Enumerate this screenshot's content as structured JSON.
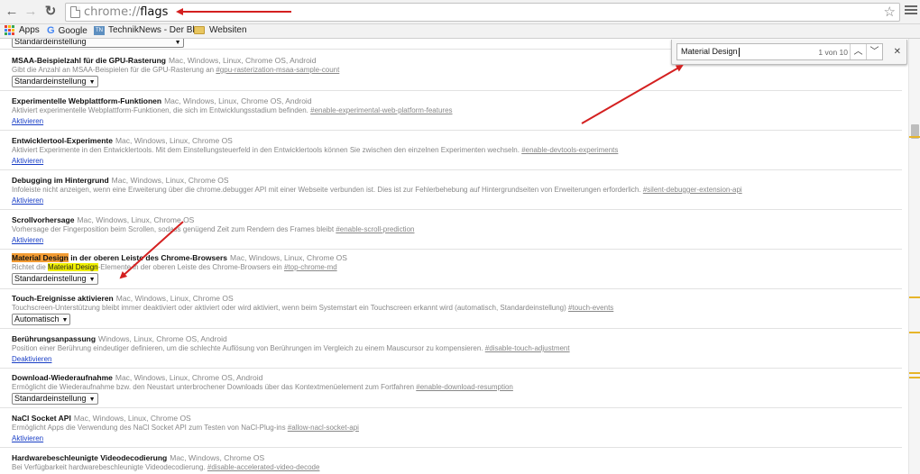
{
  "toolbar": {
    "back_icon": "back-arrow-icon",
    "forward_icon": "forward-arrow-icon",
    "reload_icon": "reload-icon",
    "url_scheme": "chrome://",
    "url_host": "flags",
    "star_icon": "bookmark-star-icon",
    "menu_icon": "hamburger-menu-icon"
  },
  "bookmarks": [
    {
      "label": "Apps",
      "icon": "apps-grid-icon"
    },
    {
      "label": "Google",
      "icon": "google-icon"
    },
    {
      "label": "TechnikNews - Der Bl",
      "icon": "technik-news-icon"
    },
    {
      "label": "Websiten",
      "icon": "folder-icon"
    }
  ],
  "find_bar": {
    "query": "Material Design",
    "count": "1 von 10",
    "prev_icon": "chevron-up-icon",
    "next_icon": "chevron-down-icon",
    "close_icon": "close-icon"
  },
  "top_partial_select": "Standardeinstellung",
  "flags": [
    {
      "title": "MSAA-Beispielzahl für die GPU-Rasterung",
      "platforms": "Mac, Windows, Linux, Chrome OS, Android",
      "desc": "Gibt die Anzahl an MSAA-Beispielen für die GPU-Rasterung an",
      "anchor": "#gpu-rasterization-msaa-sample-count",
      "control": "select",
      "value": "Standardeinstellung"
    },
    {
      "title": "Experimentelle Webplattform-Funktionen",
      "platforms": "Mac, Windows, Linux, Chrome OS, Android",
      "desc": "Aktiviert experimentelle Webplattform-Funktionen, die sich im Entwicklungsstadium befinden.",
      "anchor": "#enable-experimental-web-platform-features",
      "control": "link",
      "value": "Aktivieren"
    },
    {
      "title": "Entwicklertool-Experimente",
      "platforms": "Mac, Windows, Linux, Chrome OS",
      "desc": "Aktiviert Experimente in den Entwicklertools. Mit dem Einstellungsteuerfeld in den Entwicklertools können Sie zwischen den einzelnen Experimenten wechseln.",
      "anchor": "#enable-devtools-experiments",
      "control": "link",
      "value": "Aktivieren"
    },
    {
      "title": "Debugging im Hintergrund",
      "platforms": "Mac, Windows, Linux, Chrome OS",
      "desc": "Infoleiste nicht anzeigen, wenn eine Erweiterung über die chrome.debugger API mit einer Webseite verbunden ist. Dies ist zur Fehlerbehebung auf Hintergrundseiten von Erweiterungen erforderlich.",
      "anchor": "#silent-debugger-extension-api",
      "control": "link",
      "value": "Aktivieren"
    },
    {
      "title": "Scrollvorhersage",
      "platforms": "Mac, Windows, Linux, Chrome OS",
      "desc": "Vorhersage der Fingerposition beim Scrollen, sodass genügend Zeit zum Rendern des Frames bleibt",
      "anchor": "#enable-scroll-prediction",
      "control": "link",
      "value": "Aktivieren"
    },
    {
      "title_match": "Material Design",
      "title_rest": " in der oberen Leiste des Chrome-Browsers",
      "platforms": "Mac, Windows, Linux, Chrome OS",
      "desc_pre": "Richtet die ",
      "desc_match": "Material Design",
      "desc_post": "-Elemente in der oberen Leiste des Chrome-Browsers ein",
      "anchor": "#top-chrome-md",
      "control": "select",
      "value": "Standardeinstellung"
    },
    {
      "title": "Touch-Ereignisse aktivieren",
      "platforms": "Mac, Windows, Linux, Chrome OS",
      "desc": "Touchscreen-Unterstützung bleibt immer deaktiviert oder aktiviert oder wird aktiviert, wenn beim Systemstart ein Touchscreen erkannt wird (automatisch, Standardeinstellung)",
      "anchor": "#touch-events",
      "control": "select",
      "value": "Automatisch"
    },
    {
      "title": "Berührungsanpassung",
      "platforms": "Windows, Linux, Chrome OS, Android",
      "desc": "Position einer Berührung eindeutiger definieren, um die schlechte Auflösung von Berührungen im Vergleich zu einem Mauscursor zu kompensieren.",
      "anchor": "#disable-touch-adjustment",
      "control": "link",
      "value": "Deaktivieren"
    },
    {
      "title": "Download-Wiederaufnahme",
      "platforms": "Mac, Windows, Linux, Chrome OS, Android",
      "desc": "Ermöglicht die Wiederaufnahme bzw. den Neustart unterbrochener Downloads über das Kontextmenüelement zum Fortfahren",
      "anchor": "#enable-download-resumption",
      "control": "select",
      "value": "Standardeinstellung"
    },
    {
      "title": "NaCl Socket API",
      "platforms": "Mac, Windows, Linux, Chrome OS",
      "desc": "Ermöglicht Apps die Verwendung des NaCl Socket API zum Testen von NaCl-Plug-ins",
      "anchor": "#allow-nacl-socket-api",
      "control": "link",
      "value": "Aktivieren"
    },
    {
      "title": "Hardwarebeschleunigte Videodecodierung",
      "platforms": "Mac, Windows, Chrome OS",
      "desc": "Bei Verfügbarkeit hardwarebeschleunigte Videodecodierung.",
      "anchor": "#disable-accelerated-video-decode",
      "control": "none",
      "value": ""
    }
  ],
  "colors": {
    "annotation_arrow": "#d42020",
    "find_current_highlight": "#f39c34",
    "find_match_highlight": "#f0f000",
    "link": "#1a3fc6",
    "scrollbar_marker": "#e7b529"
  }
}
